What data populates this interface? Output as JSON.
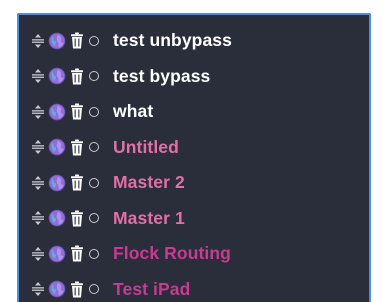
{
  "items": [
    {
      "label": "test unbypass",
      "color": "#ffffff"
    },
    {
      "label": "test bypass",
      "color": "#ffffff"
    },
    {
      "label": "what",
      "color": "#ffffff"
    },
    {
      "label": "Untitled",
      "color": "#e36fa8"
    },
    {
      "label": "Master 2",
      "color": "#e36fa8"
    },
    {
      "label": "Master 1",
      "color": "#e36fa8"
    },
    {
      "label": "Flock Routing",
      "color": "#c93a92"
    },
    {
      "label": "Test iPad",
      "color": "#c93a92"
    }
  ],
  "icons": {
    "drag": "drag-handle-icon",
    "globe": "globe-icon",
    "trash": "trash-icon",
    "radio": "radio-button"
  },
  "colors": {
    "panel_background": "#2a2d3a",
    "panel_border": "#4a90e2",
    "globe_primary": "#8e6fd6"
  }
}
